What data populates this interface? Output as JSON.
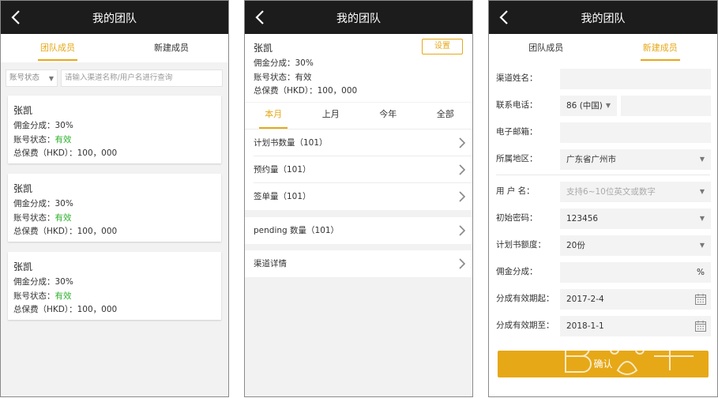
{
  "nav": {
    "title": "我的团队"
  },
  "panel1": {
    "tabs": [
      "团队成员",
      "新建成员"
    ],
    "filter": {
      "status_select": "账号状态",
      "search_placeholder": "请输入渠道名称/用户名进行查询"
    },
    "cards": [
      {
        "name": "张凯",
        "commission": "佣金分成：30%",
        "status_label": "账号状态：",
        "status_value": "有效",
        "premium": "总保费（HKD）：100，000"
      },
      {
        "name": "张凯",
        "commission": "佣金分成：30%",
        "status_label": "账号状态：",
        "status_value": "有效",
        "premium": "总保费（HKD）：100，000"
      },
      {
        "name": "张凯",
        "commission": "佣金分成：30%",
        "status_label": "账号状态：",
        "status_value": "有效",
        "premium": "总保费（HKD）：100，000"
      }
    ]
  },
  "panel2": {
    "name": "张凯",
    "commission": "佣金分成：30%",
    "status": "账号状态：有效",
    "premium": "总保费（HKD）：100，000",
    "settings_button": "设置",
    "period_tabs": [
      "本月",
      "上月",
      "今年",
      "全部"
    ],
    "rows": [
      "计划书数量（101）",
      "预约量（101）",
      "签单量（101）",
      "pending 数量（101）",
      "渠道详情"
    ]
  },
  "panel3": {
    "tabs": [
      "团队成员",
      "新建成员"
    ],
    "fields": {
      "channel_name_label": "渠道姓名：",
      "phone_label": "联系电话：",
      "phone_country": "86 (中国)",
      "email_label": "电子邮箱：",
      "region_label": "所属地区：",
      "region_value": "广东省广州市",
      "username_label": "用 户 名：",
      "username_placeholder": "支持6~10位英文或数字",
      "password_label": "初始密码：",
      "password_value": "123456",
      "quota_label": "计划书额度：",
      "quota_value": "20份",
      "commission_label": "佣金分成：",
      "commission_unit": "%",
      "start_label": "分成有效期起：",
      "start_value": "2017-2-4",
      "end_label": "分成有效期至：",
      "end_value": "2018-1-1"
    },
    "confirm_button": "确认"
  },
  "colors": {
    "accent": "#e6a817",
    "nav_bg": "#1c1c1c",
    "valid_green": "#2bb12b"
  }
}
